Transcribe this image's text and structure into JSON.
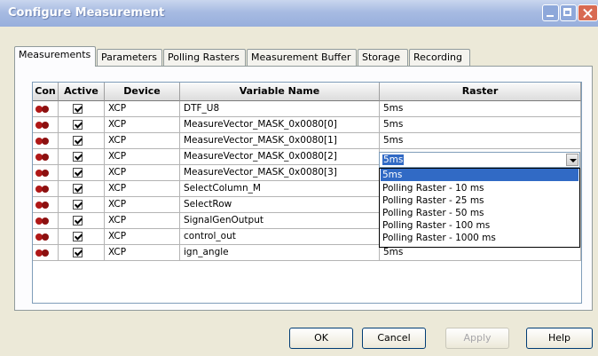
{
  "window": {
    "title": "Configure Measurement"
  },
  "tabs": [
    {
      "label": "Measurements",
      "active": true
    },
    {
      "label": "Parameters"
    },
    {
      "label": "Polling Rasters"
    },
    {
      "label": "Measurement Buffer"
    },
    {
      "label": "Storage"
    },
    {
      "label": "Recording"
    }
  ],
  "table": {
    "columns": [
      "Con",
      "Active",
      "Device",
      "Variable Name",
      "Raster"
    ],
    "rows": [
      {
        "device": "XCP",
        "variable": "DTF_U8",
        "raster": "5ms",
        "active": true
      },
      {
        "device": "XCP",
        "variable": "MeasureVector_MASK_0x0080[0]",
        "raster": "5ms",
        "active": true
      },
      {
        "device": "XCP",
        "variable": "MeasureVector_MASK_0x0080[1]",
        "raster": "5ms",
        "active": true
      },
      {
        "device": "XCP",
        "variable": "MeasureVector_MASK_0x0080[2]",
        "raster": "5ms",
        "active": true
      },
      {
        "device": "XCP",
        "variable": "MeasureVector_MASK_0x0080[3]",
        "raster": "",
        "active": true
      },
      {
        "device": "XCP",
        "variable": "SelectColumn_M",
        "raster": "",
        "active": true
      },
      {
        "device": "XCP",
        "variable": "SelectRow",
        "raster": "",
        "active": true
      },
      {
        "device": "XCP",
        "variable": "SignalGenOutput",
        "raster": "",
        "active": true
      },
      {
        "device": "XCP",
        "variable": "control_out",
        "raster": "",
        "active": true
      },
      {
        "device": "XCP",
        "variable": "ign_angle",
        "raster": "5ms",
        "active": true
      }
    ]
  },
  "raster_dropdown": {
    "selected": "5ms",
    "options": [
      "5ms",
      "Polling Raster - 10 ms",
      "Polling Raster - 25 ms",
      "Polling Raster - 50 ms",
      "Polling Raster - 100 ms",
      "Polling Raster - 1000 ms"
    ]
  },
  "buttons": {
    "ok": "OK",
    "cancel": "Cancel",
    "apply": "Apply",
    "help": "Help"
  },
  "colors": {
    "titlebar": "#a7bbe2",
    "selection": "#316ac5",
    "connected": "#b01818"
  }
}
